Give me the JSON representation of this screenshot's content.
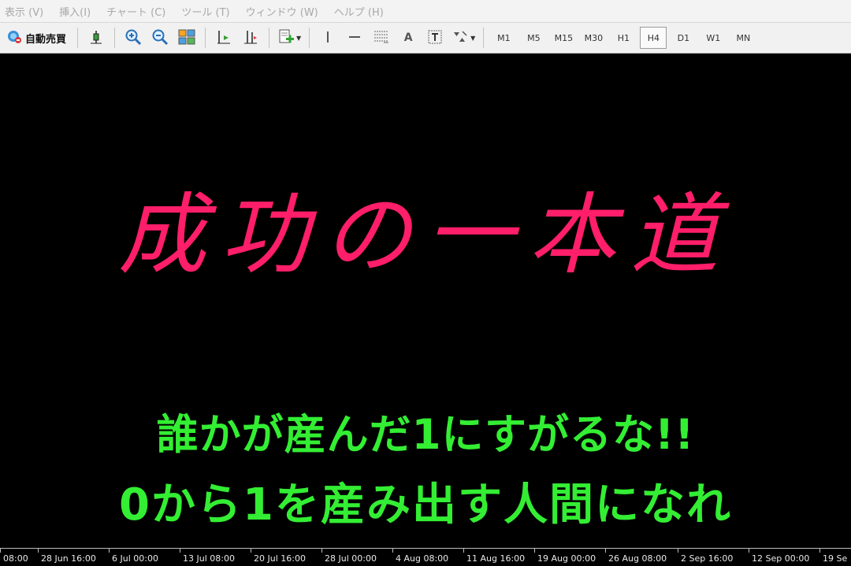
{
  "menu": [
    "表示 (V)",
    "挿入(I)",
    "チャート (C)",
    "ツール (T)",
    "ウィンドウ (W)",
    "ヘルプ (H)"
  ],
  "toolbar": {
    "autotrade_label": "自動売買",
    "text_tool_label": "A",
    "timeframes": [
      "M1",
      "M5",
      "M15",
      "M30",
      "H1",
      "H4",
      "D1",
      "W1",
      "MN"
    ],
    "active_timeframe": "H4"
  },
  "chart": {
    "title": "成功の一本道",
    "line1": "誰かが産んだ1にすがるな!!",
    "line2": "0から1を産み出す人間になれ",
    "title_color": "#ff1e6a",
    "text_color": "#33ee33"
  },
  "time_axis": [
    "08:00",
    "28 Jun 16:00",
    "6 Jul 00:00",
    "13 Jul 08:00",
    "20 Jul 16:00",
    "28 Jul 00:00",
    "4 Aug 08:00",
    "11 Aug 16:00",
    "19 Aug 00:00",
    "26 Aug 08:00",
    "2 Sep 16:00",
    "12 Sep 00:00",
    "19 Se"
  ]
}
